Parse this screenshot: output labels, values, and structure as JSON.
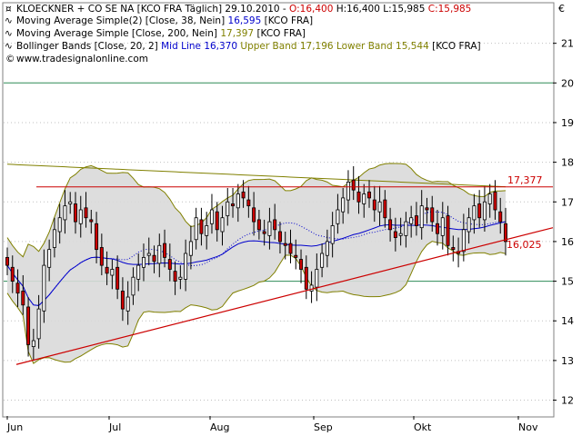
{
  "header": {
    "symbol_line": {
      "name": "KLOECKNER + CO SE NA [KCO FRA  Täglich] 29.10.2010 - ",
      "open": "O:16,400",
      "high": "H:16,400",
      "low": "L:15,985",
      "close": "C:15,985"
    },
    "indicators": [
      {
        "label": "Moving Average Simple(2) [Close, 38, Nein]",
        "value": "16,595",
        "suffix": "[KCO FRA]",
        "color": "#0000cc"
      },
      {
        "label": "Moving Average Simple [Close, 200, Nein]",
        "value": "17,397",
        "suffix": "[KCO FRA]",
        "color": "#808000"
      },
      {
        "label": "Bollinger Bands [Close, 20, 2]",
        "value": "Mid Line 16,370",
        "value2": "Upper Band 17,196 Lower Band 15,544",
        "suffix": "[KCO FRA]",
        "color": "#0000cc",
        "color2": "#808000"
      }
    ],
    "copyright": "www.tradesignalonline.com"
  },
  "currency_symbol": "€",
  "colors": {
    "up_candle": "#ffffff",
    "down_candle": "#cc0000",
    "ma38": "#0000cc",
    "ma200": "#808000",
    "boll_fill": "#d9d9d9",
    "boll_edge": "#808000",
    "trendline": "#cc0000",
    "grid_green": "#2e8b57"
  },
  "chart_data": {
    "type": "candlestick",
    "x_labels": [
      "Jun",
      "Jul",
      "Aug",
      "Sep",
      "Okt",
      "Nov"
    ],
    "y_ticks": [
      12,
      13,
      14,
      15,
      16,
      17,
      18,
      19,
      20,
      21
    ],
    "ylim": [
      11.6,
      22.0
    ],
    "annotations": [
      {
        "label": "17,377",
        "value": 17.377
      },
      {
        "label": "16,025",
        "value": 16.025
      }
    ],
    "resistance_level": 17.377,
    "support_trendline": [
      [
        13.0,
        12.9
      ],
      [
        13.0,
        12.9
      ]
    ],
    "closes": [
      15.4,
      15.0,
      14.7,
      14.4,
      13.4,
      13.5,
      14.3,
      15.4,
      15.8,
      16.3,
      16.6,
      16.9,
      17.0,
      16.5,
      16.8,
      16.6,
      16.5,
      15.8,
      15.4,
      15.2,
      15.3,
      14.8,
      14.3,
      14.6,
      15.1,
      15.4,
      15.6,
      15.7,
      15.5,
      15.9,
      15.6,
      15.3,
      15.0,
      15.1,
      15.7,
      16.0,
      16.6,
      16.2,
      16.4,
      16.8,
      16.3,
      16.6,
      17.0,
      16.9,
      17.2,
      17.1,
      16.9,
      16.5,
      16.3,
      16.2,
      16.5,
      16.3,
      16.0,
      15.9,
      15.7,
      15.6,
      15.3,
      14.8,
      14.9,
      15.3,
      15.7,
      16.0,
      16.4,
      16.8,
      17.1,
      17.5,
      17.3,
      17.0,
      17.2,
      17.1,
      16.8,
      17.0,
      16.6,
      16.3,
      16.1,
      16.2,
      16.5,
      16.6,
      16.4,
      16.9,
      16.8,
      16.5,
      16.2,
      16.6,
      15.9,
      15.8,
      15.7,
      16.3,
      16.6,
      16.9,
      16.6,
      17.0,
      17.2,
      16.8,
      16.5,
      16.0
    ],
    "series": [
      {
        "name": "Moving Average Simple(2) [Close, 38, Nein]"
      },
      {
        "name": "Moving Average Simple [Close, 200, Nein]"
      },
      {
        "name": "Bollinger Bands [Close, 20, 2]"
      }
    ]
  }
}
